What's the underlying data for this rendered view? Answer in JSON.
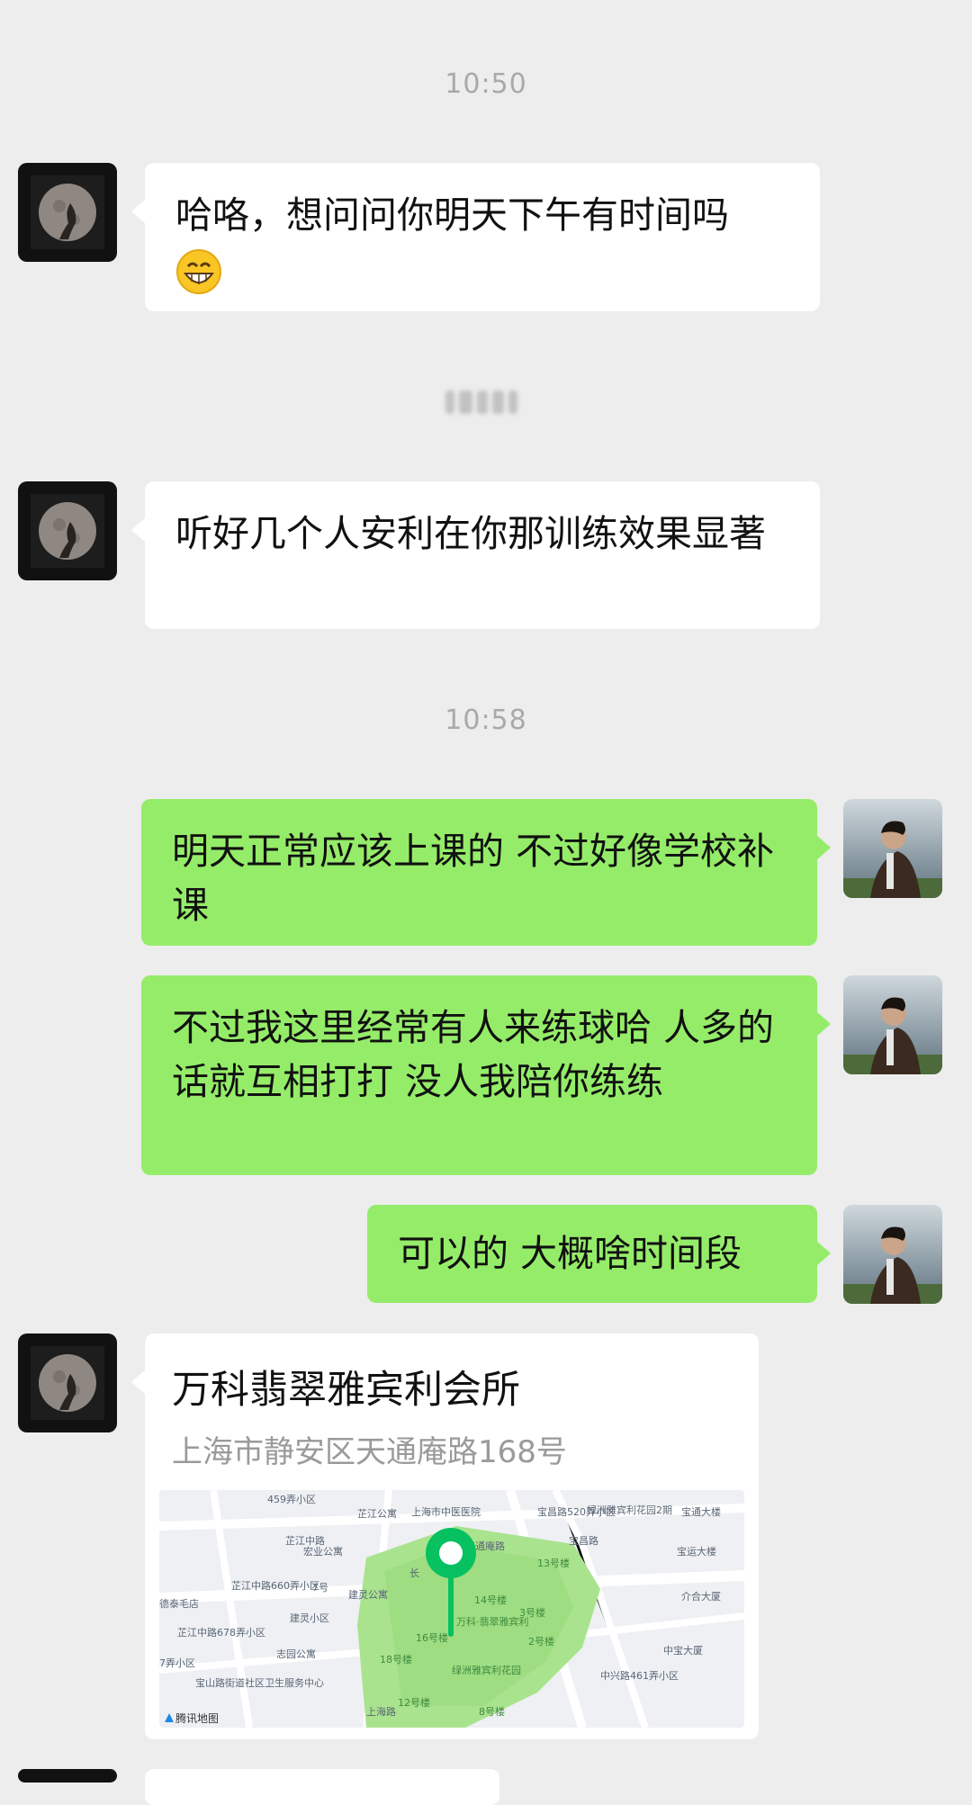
{
  "chat": {
    "time1": "10:50",
    "msg1": "哈咯，想问问你明天下午有时间吗",
    "msg2": "听好几个人安利在你那训练效果显著",
    "time2": "10:58",
    "msg3": "明天正常应该上课的 不过好像学校补课",
    "msg4": "不过我这里经常有人来练球哈 人多的话就互相打打 没人我陪你练练",
    "msg5": "可以的 大概啥时间段"
  },
  "location": {
    "title": "万科翡翠雅宾利会所",
    "address": "上海市静安区天通庵路168号",
    "map_provider": "腾讯地图",
    "map_labels": [
      "上海市中医医院",
      "459弄小区",
      "芷江公寓",
      "宝昌路520弄小区",
      "绿洲雅宾利花园2期",
      "宝通大楼",
      "宝运大楼",
      "芷江中路",
      "宏业公寓",
      "芷江中路660弄小区",
      "7号",
      "建灵公寓",
      "13号楼",
      "14号楼",
      "万科·翡翠雅宾利",
      "3号楼",
      "介合大厦",
      "德泰毛店",
      "芷江中路678弄小区",
      "建灵小区",
      "16号楼",
      "2号楼",
      "宝山路街道社区卫生服务中心",
      "志园公寓",
      "18号楼",
      "绿洲雅宾利花园",
      "中兴路461弄小区",
      "中宝大厦",
      "12号楼",
      "8号楼",
      "7弄小区",
      "上海路",
      "天通庵路",
      "宝昌路",
      "长"
    ]
  },
  "icons": {
    "emoji": "grinning-face-emoji",
    "map_pin": "location-pin-icon"
  },
  "colors": {
    "background": "#ededed",
    "bubble_self": "#95ec69",
    "bubble_other": "#ffffff",
    "timestamp": "#a9a9a9"
  }
}
